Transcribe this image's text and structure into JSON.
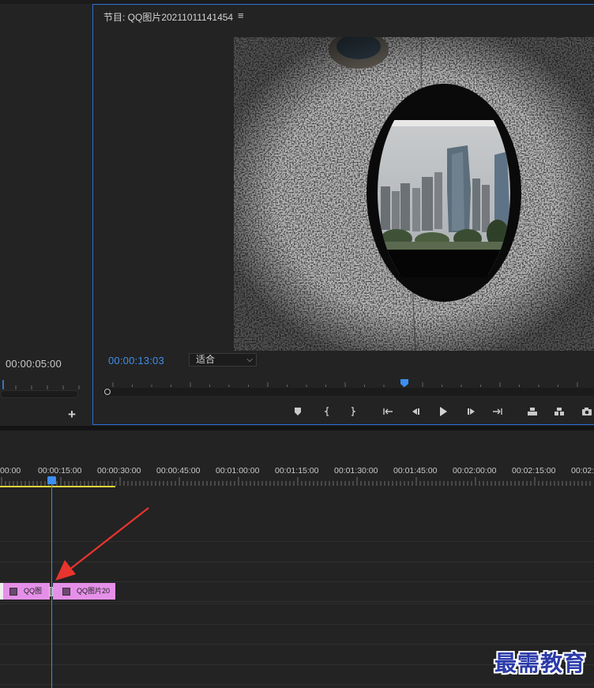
{
  "source_monitor": {
    "timecode": "00:00:05:00"
  },
  "program_monitor": {
    "title": "节目: QQ图片20211011141454",
    "menu_icon": "hamburger-icon",
    "timecode": "00:00:13:03",
    "fit_label": "适合",
    "controls": [
      {
        "name": "add-marker-button",
        "icon": "marker-icon"
      },
      {
        "name": "mark-in-button",
        "icon": "mark-in-icon"
      },
      {
        "name": "mark-out-button",
        "icon": "mark-out-icon"
      },
      {
        "name": "go-to-in-button",
        "icon": "go-to-in-icon"
      },
      {
        "name": "step-back-button",
        "icon": "step-back-icon"
      },
      {
        "name": "play-button",
        "icon": "play-icon"
      },
      {
        "name": "step-forward-button",
        "icon": "step-forward-icon"
      },
      {
        "name": "go-to-out-button",
        "icon": "go-to-out-icon"
      },
      {
        "name": "lift-button",
        "icon": "lift-icon"
      },
      {
        "name": "extract-button",
        "icon": "extract-icon"
      },
      {
        "name": "export-frame-button",
        "icon": "camera-icon"
      }
    ]
  },
  "timeline": {
    "ruler_labels": [
      "00:00",
      "00:00:15:00",
      "00:00:30:00",
      "00:00:45:00",
      "00:01:00:00",
      "00:01:15:00",
      "00:01:30:00",
      "00:01:45:00",
      "00:02:00:00",
      "00:02:15:00",
      "00:02:"
    ],
    "clips": [
      {
        "label": "QQ图"
      },
      {
        "label": "QQ图片20"
      }
    ]
  },
  "colors": {
    "accent": "#3b8ff0",
    "clip": "#e590e8",
    "work_area": "#e3d43a",
    "annotation_arrow": "#e8342e"
  },
  "watermark": "最需教育"
}
